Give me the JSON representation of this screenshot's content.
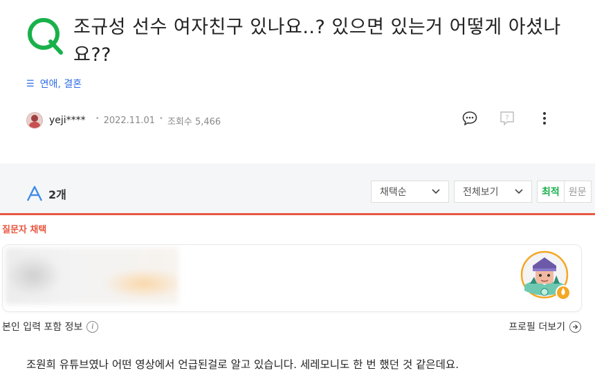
{
  "question": {
    "title": "조규성 선수 여자친구 있나요..? 있으면 있는거 어떻게 아셨나요??",
    "category_icon": "☰",
    "category": "연애, 결혼",
    "author": "yeji****",
    "date": "2022.11.01",
    "views_label": "조회수 5,466"
  },
  "answers": {
    "count_label": "2개",
    "sort_select": "채택순",
    "view_select": "전체보기",
    "toggle_on": "최적",
    "toggle_off": "원문",
    "selected_label": "질문자 채택",
    "info_label": "본인 입력 포함 정보",
    "info_icon_label": "i",
    "profile_more": "프로필 더보기",
    "text": "조원희 유튜브였나 어떤 영상에서 언급된걸로 알고 있습니다. 세레모니도 한 번 했던 것 같은데요."
  },
  "colors": {
    "accent_green": "#19b14a",
    "accent_blue": "#2e6ce6",
    "selected_red": "#e8563f"
  }
}
